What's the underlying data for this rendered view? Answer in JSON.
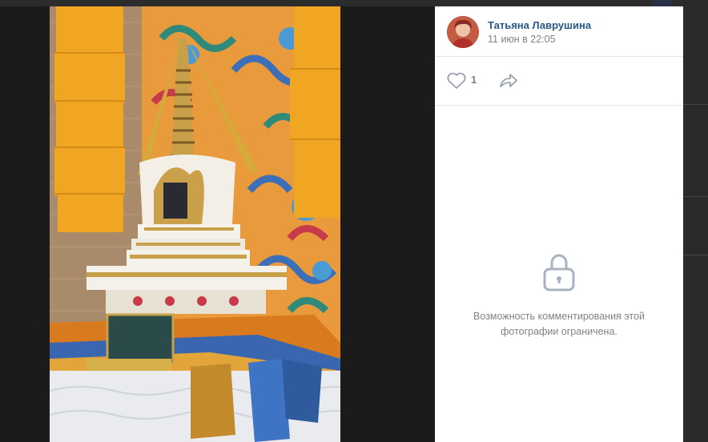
{
  "post": {
    "author_name": "Татьяна Лаврушина",
    "date": "11 июн в 22:05",
    "likes_count": "1"
  },
  "comments": {
    "restricted_line1": "Возможность комментирования этой",
    "restricted_line2": "фотографии ограничена."
  },
  "icons": [
    "heart-icon",
    "share-icon",
    "lock-icon"
  ],
  "colors": {
    "link": "#2a5885",
    "muted": "#828282",
    "divider": "#e7e8ec",
    "lock": "#a8b3c2"
  }
}
